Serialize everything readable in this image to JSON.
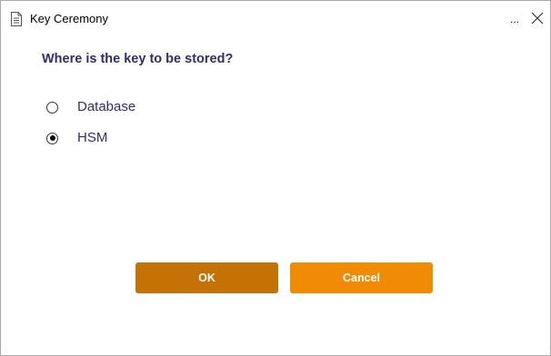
{
  "window": {
    "title": "Key Ceremony",
    "more_label": "...",
    "close_label": "close"
  },
  "prompt": {
    "question": "Where is the key to be stored?"
  },
  "storage_options": [
    {
      "label": "Database",
      "selected": false
    },
    {
      "label": "HSM",
      "selected": true
    }
  ],
  "buttons": {
    "ok_label": "OK",
    "cancel_label": "Cancel"
  },
  "colors": {
    "ok_button": "#c47105",
    "cancel_button": "#f28b04",
    "text_accent": "#2e2e6e"
  },
  "icons": {
    "title_icon": "document-icon",
    "close_icon": "close-icon"
  }
}
